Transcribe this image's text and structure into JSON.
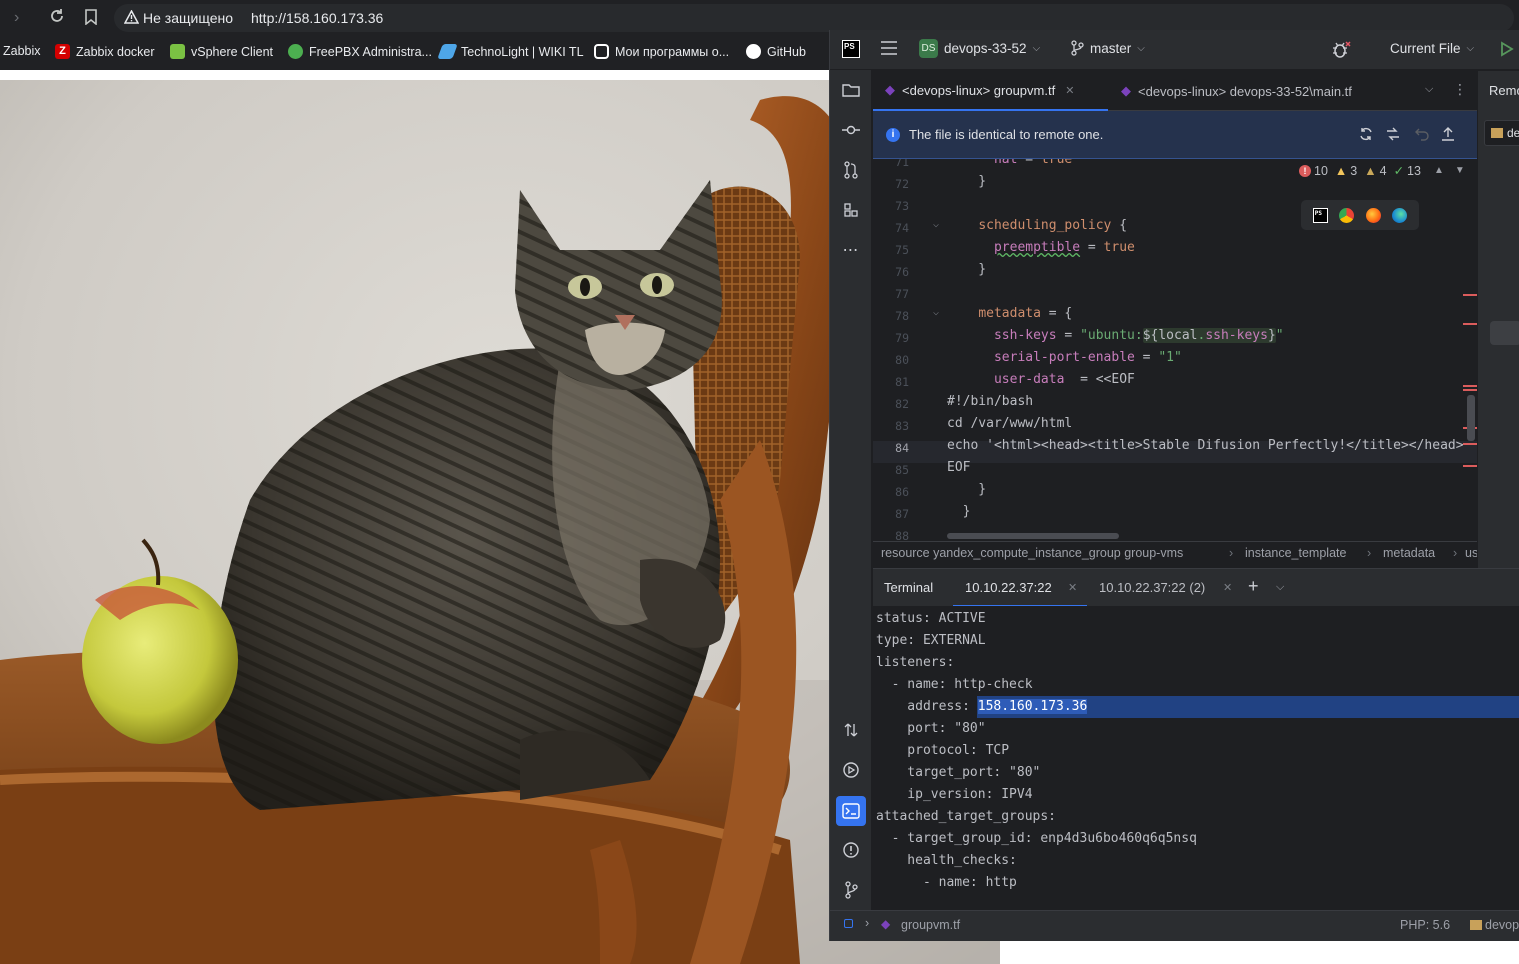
{
  "browser": {
    "security_label": "Не защищено",
    "url": "http://158.160.173.36",
    "bookmarks": [
      {
        "label": "Zabbix",
        "icon": "none",
        "color": ""
      },
      {
        "label": "Zabbix docker",
        "icon": "zabbix-z-icon",
        "color": "#d40000"
      },
      {
        "label": "vSphere Client",
        "icon": "vsphere-icon",
        "color": "#7ac143"
      },
      {
        "label": "FreePBX Administra...",
        "icon": "freepbx-icon",
        "color": "#4caf50"
      },
      {
        "label": "TechnoLight | WIKI TL",
        "icon": "technolight-icon",
        "color": "#4ea6e8"
      },
      {
        "label": "Мои программы о...",
        "icon": "discord-icon",
        "color": "#ffffff"
      },
      {
        "label": "GitHub",
        "icon": "github-icon",
        "color": "#ffffff"
      }
    ]
  },
  "ide": {
    "project_badge": "DS",
    "project_name": "devops-33-52",
    "branch": "master",
    "run_config": "Current File",
    "tabs": [
      {
        "label": "<devops-linux> groupvm.tf",
        "active": true
      },
      {
        "label": "<devops-linux> devops-33-52\\main.tf",
        "active": false
      }
    ],
    "right_panel_label": "Remo",
    "right_panel_item": "de",
    "banner_text": "The file is identical to remote one.",
    "inspections": {
      "errors": "10",
      "warnings": "3",
      "weak_warnings": "4",
      "ok": "13"
    },
    "editor_lines": [
      {
        "num": "71",
        "text": "      nat = true"
      },
      {
        "num": "72",
        "text": "    }"
      },
      {
        "num": "73",
        "text": ""
      },
      {
        "num": "74",
        "text": "    scheduling_policy {"
      },
      {
        "num": "75",
        "text": "      preemptible = true"
      },
      {
        "num": "76",
        "text": "    }"
      },
      {
        "num": "77",
        "text": ""
      },
      {
        "num": "78",
        "text": "    metadata = {"
      },
      {
        "num": "79",
        "text": "      ssh-keys = \"ubuntu:${local.ssh-keys}\""
      },
      {
        "num": "80",
        "text": "      serial-port-enable = \"1\""
      },
      {
        "num": "81",
        "text": "      user-data  = <<EOF"
      },
      {
        "num": "82",
        "text": "#!/bin/bash"
      },
      {
        "num": "83",
        "text": "cd /var/www/html"
      },
      {
        "num": "84",
        "text": "echo '<html><head><title>Stable Difusion Perfectly!</title></head>"
      },
      {
        "num": "85",
        "text": "EOF"
      },
      {
        "num": "86",
        "text": "    }"
      },
      {
        "num": "87",
        "text": "  }"
      },
      {
        "num": "88",
        "text": ""
      }
    ],
    "breadcrumb": [
      "resource yandex_compute_instance_group group-vms",
      "instance_template",
      "metadata",
      "us"
    ],
    "terminal": {
      "title": "Terminal",
      "tabs": [
        "10.10.22.37:22",
        "10.10.22.37:22 (2)"
      ],
      "lines": [
        "status: ACTIVE",
        "type: EXTERNAL",
        "listeners:",
        "  - name: http-check",
        "    address: 158.160.173.36",
        "    port: \"80\"",
        "    protocol: TCP",
        "    target_port: \"80\"",
        "    ip_version: IPV4",
        "attached_target_groups:",
        "  - target_group_id: enp4d3u6bo460q6q5nsq",
        "    health_checks:",
        "      - name: http"
      ],
      "highlight_value": "158.160.173.36"
    },
    "status_bar": {
      "file": "groupvm.tf",
      "php": "PHP: 5.6",
      "remote": "devop"
    }
  }
}
